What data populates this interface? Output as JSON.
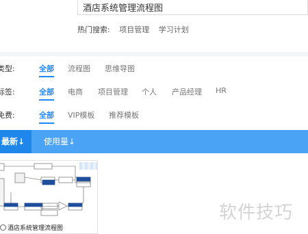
{
  "search": {
    "value": "酒店系统管理流程图"
  },
  "hot_search": {
    "label": "热门搜索:",
    "keywords": [
      "项目管理",
      "学习计划"
    ]
  },
  "filters": [
    {
      "category": "类型:",
      "options": [
        "全部",
        "流程图",
        "思维导图"
      ],
      "active": "全部"
    },
    {
      "category": "标签:",
      "options": [
        "全部",
        "电商",
        "项目管理",
        "个人",
        "产品经理",
        "HR"
      ],
      "active": "全部"
    },
    {
      "category": "免费:",
      "options": [
        "全部",
        "VIP模板",
        "推荐模板"
      ],
      "active": "全部"
    }
  ],
  "sort": {
    "items": [
      "最新↓",
      "使用量↓"
    ],
    "active": "最新↓"
  },
  "cards": [
    {
      "title": "酒店系统管理流程图",
      "icon": "template-icon"
    }
  ],
  "watermark": "软件技巧",
  "colors": {
    "accent": "#1e88ff",
    "sort_bar": "#4aa3f5",
    "sort_active": "#1f86ea"
  }
}
